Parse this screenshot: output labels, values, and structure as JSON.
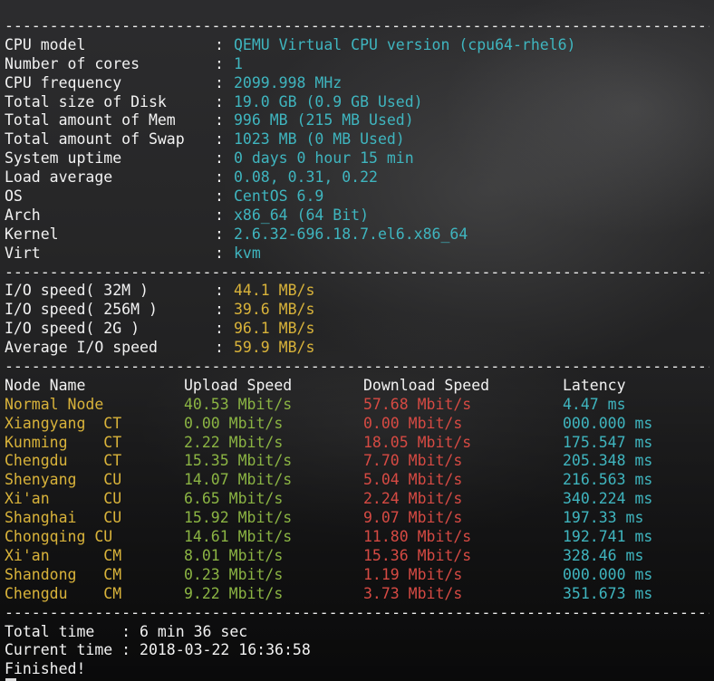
{
  "colors": {
    "label": "#f2f2f2",
    "sysinfo_value": "#3fb5bf",
    "io_value": "#d9b33a",
    "node_name": "#d9b33a",
    "upload": "#8bb443",
    "download": "#d64a43",
    "latency": "#3fb5bf"
  },
  "separator": "------------------------------------------------------------------------------------------------",
  "sysinfo": [
    {
      "label": "CPU model",
      "value": "QEMU Virtual CPU version (cpu64-rhel6)"
    },
    {
      "label": "Number of cores",
      "value": "1"
    },
    {
      "label": "CPU frequency",
      "value": "2099.998 MHz"
    },
    {
      "label": "Total size of Disk",
      "value": "19.0 GB (0.9 GB Used)"
    },
    {
      "label": "Total amount of Mem",
      "value": "996 MB (215 MB Used)"
    },
    {
      "label": "Total amount of Swap",
      "value": "1023 MB (0 MB Used)"
    },
    {
      "label": "System uptime",
      "value": "0 days 0 hour 15 min"
    },
    {
      "label": "Load average",
      "value": "0.08, 0.31, 0.22"
    },
    {
      "label": "OS",
      "value": "CentOS 6.9"
    },
    {
      "label": "Arch",
      "value": "x86_64 (64 Bit)"
    },
    {
      "label": "Kernel",
      "value": "2.6.32-696.18.7.el6.x86_64"
    },
    {
      "label": "Virt",
      "value": "kvm"
    }
  ],
  "io": [
    {
      "label": "I/O speed( 32M )",
      "value": "44.1 MB/s"
    },
    {
      "label": "I/O speed( 256M )",
      "value": "39.6 MB/s"
    },
    {
      "label": "I/O speed( 2G )",
      "value": "96.1 MB/s"
    },
    {
      "label": "Average I/O speed",
      "value": "59.9 MB/s"
    }
  ],
  "speedtest": {
    "headers": [
      "Node Name",
      "Upload Speed",
      "Download Speed",
      "Latency"
    ],
    "rows": [
      {
        "node": "Normal Node",
        "upload": "40.53 Mbit/s",
        "download": "57.68 Mbit/s",
        "latency": "4.47 ms"
      },
      {
        "node": "Xiangyang  CT",
        "upload": "0.00 Mbit/s",
        "download": "0.00 Mbit/s",
        "latency": "000.000 ms"
      },
      {
        "node": "Kunming    CT",
        "upload": "2.22 Mbit/s",
        "download": "18.05 Mbit/s",
        "latency": "175.547 ms"
      },
      {
        "node": "Chengdu    CT",
        "upload": "15.35 Mbit/s",
        "download": "7.70 Mbit/s",
        "latency": "205.348 ms"
      },
      {
        "node": "Shenyang   CU",
        "upload": "14.07 Mbit/s",
        "download": "5.04 Mbit/s",
        "latency": "216.563 ms"
      },
      {
        "node": "Xi'an      CU",
        "upload": "6.65 Mbit/s",
        "download": "2.24 Mbit/s",
        "latency": "340.224 ms"
      },
      {
        "node": "Shanghai   CU",
        "upload": "15.92 Mbit/s",
        "download": "9.07 Mbit/s",
        "latency": "197.33 ms"
      },
      {
        "node": "Chongqing CU",
        "upload": "14.61 Mbit/s",
        "download": "11.80 Mbit/s",
        "latency": "192.741 ms"
      },
      {
        "node": "Xi'an      CM",
        "upload": "8.01 Mbit/s",
        "download": "15.36 Mbit/s",
        "latency": "328.46 ms"
      },
      {
        "node": "Shandong   CM",
        "upload": "0.23 Mbit/s",
        "download": "1.19 Mbit/s",
        "latency": "000.000 ms"
      },
      {
        "node": "Chengdu    CM",
        "upload": "9.22 Mbit/s",
        "download": "3.73 Mbit/s",
        "latency": "351.673 ms"
      }
    ]
  },
  "summary": {
    "total_time_line": "Total time   : 6 min 36 sec",
    "current_time_line": "Current time : 2018-03-22 16:36:58",
    "finished": "Finished!"
  }
}
